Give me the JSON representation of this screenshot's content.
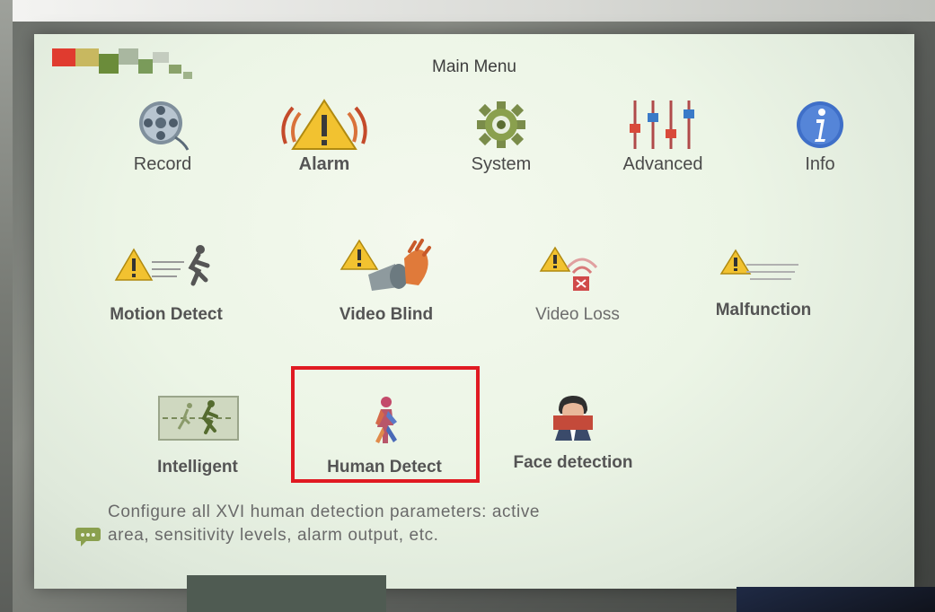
{
  "menu": {
    "title": "Main Menu"
  },
  "categories": [
    {
      "label": "Record",
      "icon": "reel-icon"
    },
    {
      "label": "Alarm",
      "icon": "alarm-warning-icon"
    },
    {
      "label": "System",
      "icon": "gear-icon"
    },
    {
      "label": "Advanced",
      "icon": "sliders-icon"
    },
    {
      "label": "Info",
      "icon": "info-icon"
    }
  ],
  "items": [
    {
      "label": "Motion Detect",
      "icon": "motion-detect-icon"
    },
    {
      "label": "Video Blind",
      "icon": "video-blind-icon"
    },
    {
      "label": "Video Loss",
      "icon": "video-loss-icon"
    },
    {
      "label": "Malfunction",
      "icon": "malfunction-icon"
    },
    {
      "label": "Intelligent",
      "icon": "intelligent-icon"
    },
    {
      "label": "Human Detect",
      "icon": "human-detect-icon"
    },
    {
      "label": "Face detection",
      "icon": "face-detection-icon"
    }
  ],
  "help": {
    "line1": "Configure all XVI human detection parameters: active",
    "line2": "area, sensitivity levels, alarm output, etc."
  },
  "colors": {
    "highlight": "#e01a22",
    "alarm_yellow": "#f2c230",
    "info_blue": "#3f6fc8"
  }
}
